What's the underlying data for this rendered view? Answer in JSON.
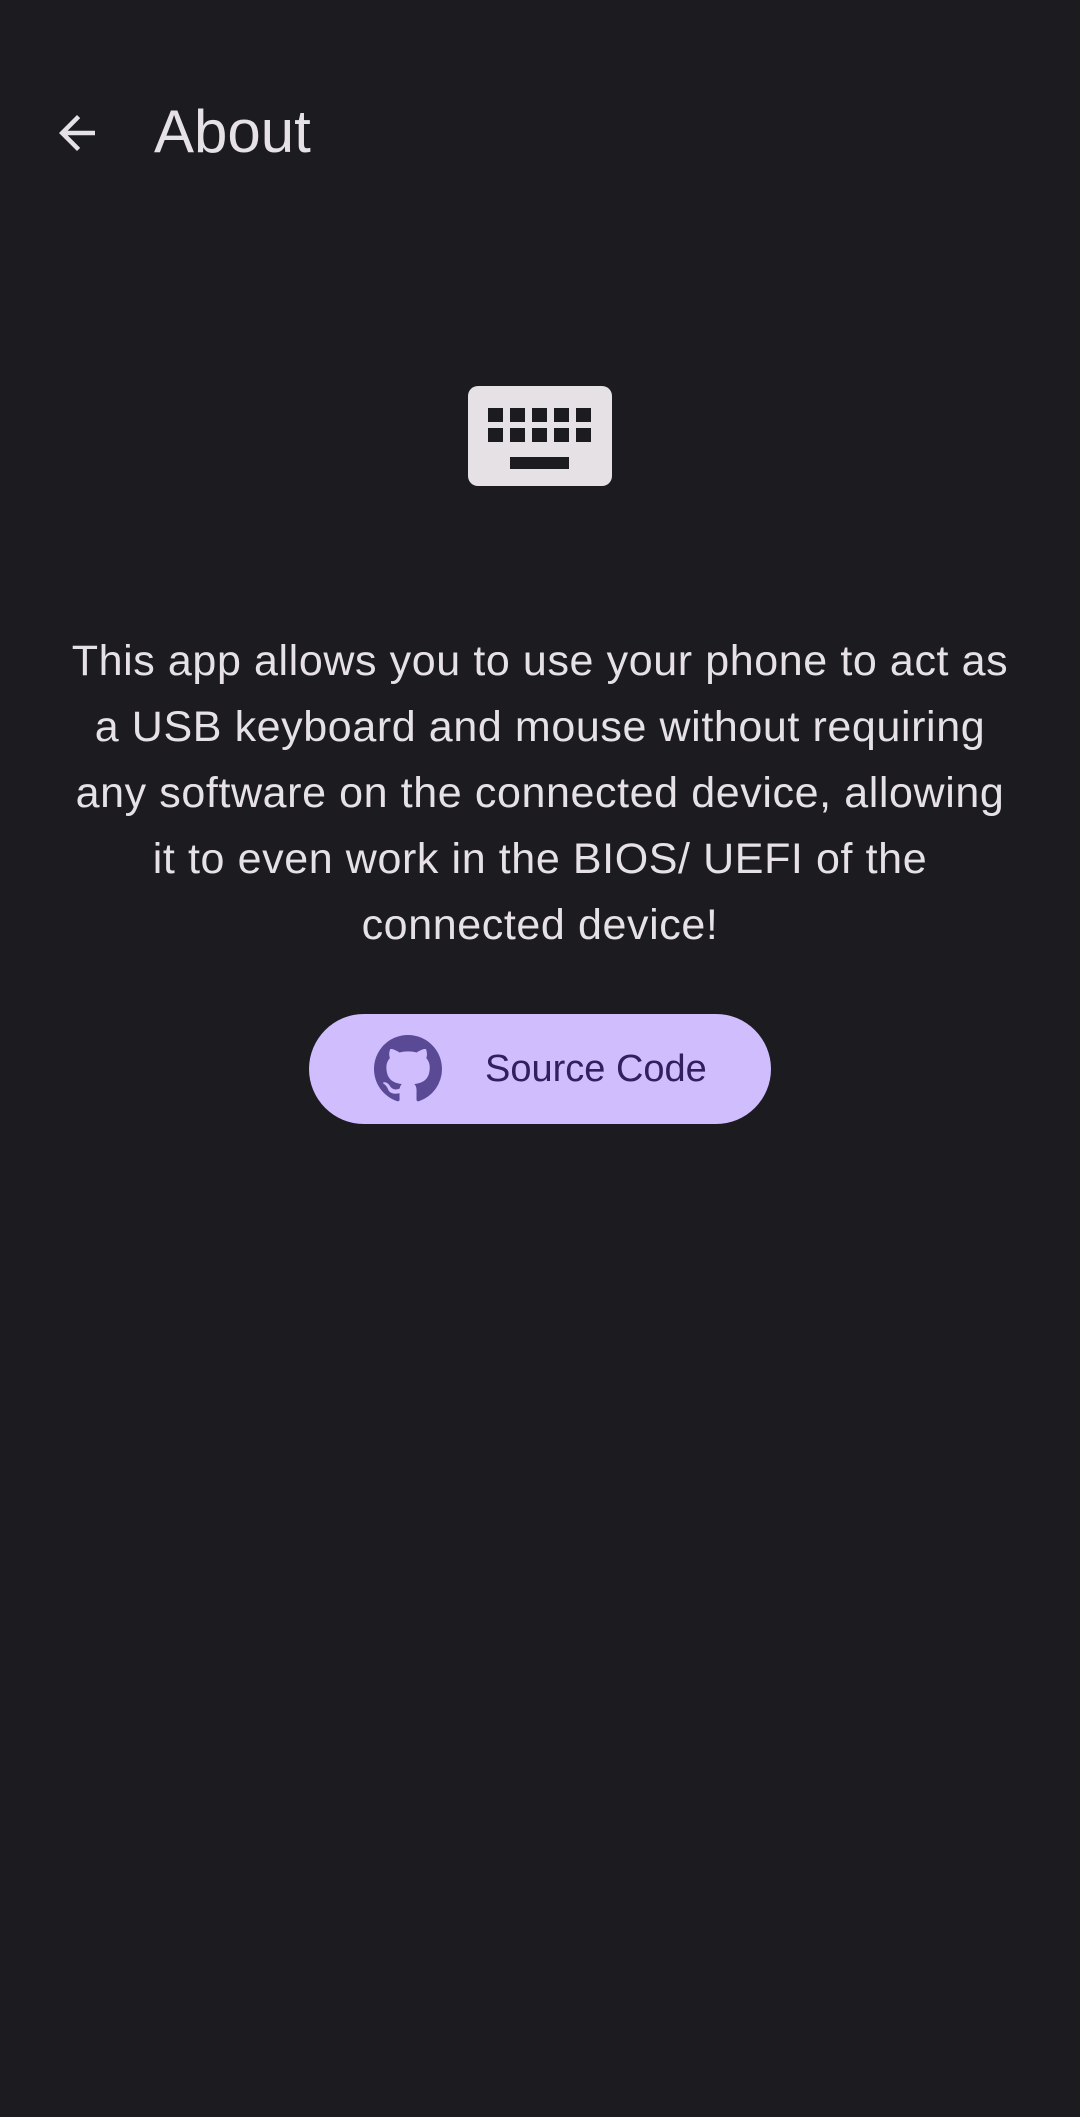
{
  "header": {
    "back_icon": "arrow-back-icon",
    "title": "About"
  },
  "hero": {
    "icon": "keyboard-icon",
    "icon_color": "#e6e1e5"
  },
  "main": {
    "description": "This app allows you to use your phone to act as a USB keyboard and mouse without requiring any software on the connected device, allowing it to even work in the BIOS/ UEFI of the connected device!"
  },
  "source_button": {
    "icon": "github-icon",
    "label": "Source Code",
    "background": "#cfbdfd",
    "foreground": "#30205f"
  },
  "theme": {
    "background": "#1c1b20",
    "text": "#e6e1e5"
  }
}
